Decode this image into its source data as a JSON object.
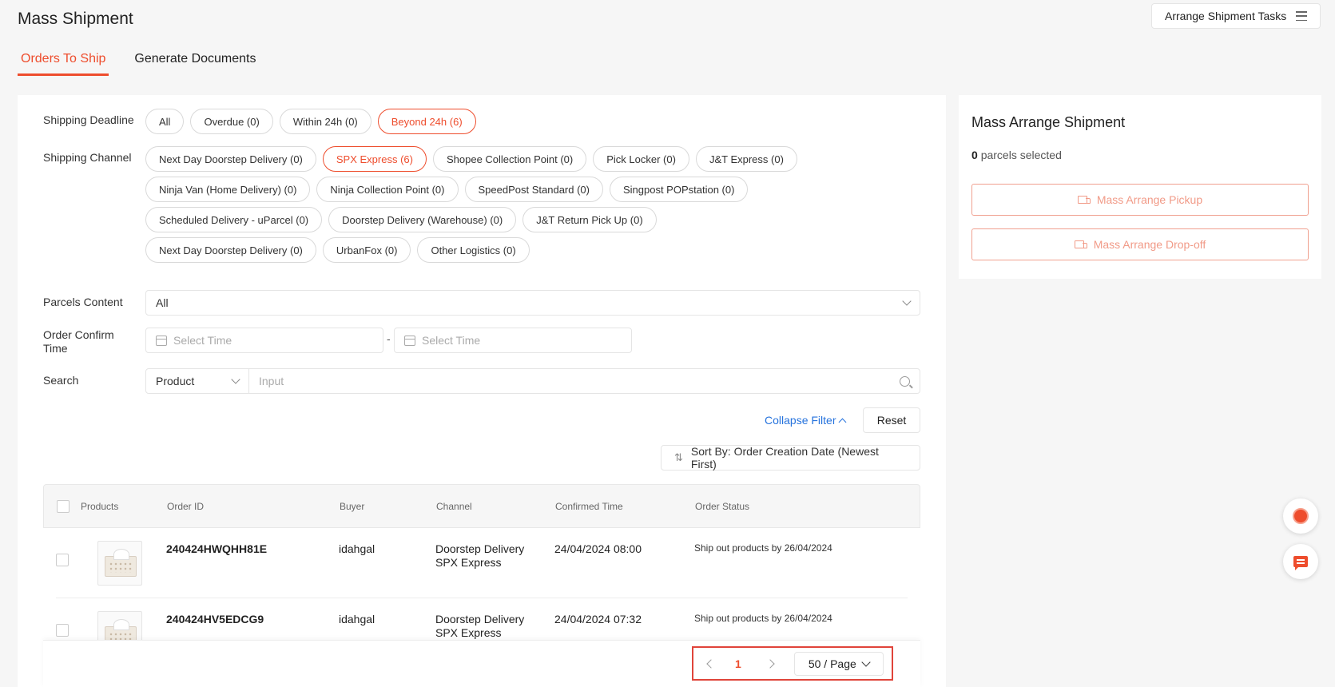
{
  "header": {
    "title": "Mass Shipment",
    "tasks_button": "Arrange Shipment Tasks"
  },
  "tabs": [
    {
      "label": "Orders To Ship",
      "active": true
    },
    {
      "label": "Generate Documents",
      "active": false
    }
  ],
  "filters": {
    "deadline_label": "Shipping Deadline",
    "deadline_options": [
      "All",
      "Overdue (0)",
      "Within 24h (0)",
      "Beyond 24h (6)"
    ],
    "deadline_selected": "Beyond 24h (6)",
    "channel_label": "Shipping Channel",
    "channel_options": [
      "Next Day Doorstep Delivery (0)",
      "SPX Express (6)",
      "Shopee Collection Point (0)",
      "Pick Locker (0)",
      "J&T Express (0)",
      "Ninja Van (Home Delivery) (0)",
      "Ninja Collection Point (0)",
      "SpeedPost Standard (0)",
      "Singpost POPstation (0)",
      "Scheduled Delivery - uParcel (0)",
      "Doorstep Delivery (Warehouse) (0)",
      "J&T Return Pick Up (0)",
      "Next Day Doorstep Delivery (0)",
      "UrbanFox (0)",
      "Other Logistics (0)"
    ],
    "channel_selected": "SPX Express (6)",
    "parcels_label": "Parcels Content",
    "parcels_value": "All",
    "confirm_label": "Order Confirm Time",
    "time_placeholder_start": "Select Time",
    "time_placeholder_end": "Select Time",
    "time_separator": "-",
    "search_label": "Search",
    "search_type": "Product",
    "search_placeholder": "Input",
    "collapse_label": "Collapse Filter",
    "reset_label": "Reset",
    "sort_label": "Sort By: Order Creation Date (Newest First)"
  },
  "table": {
    "headers": [
      "Products",
      "Order ID",
      "Buyer",
      "Channel",
      "Confirmed Time",
      "Order Status"
    ],
    "rows": [
      {
        "order_id": "240424HWQHH81E",
        "buyer": "idahgal",
        "channel_line1": "Doorstep Delivery",
        "channel_line2": "SPX Express",
        "confirmed": "24/04/2024 08:00",
        "status": "Ship out products by 26/04/2024"
      },
      {
        "order_id": "240424HV5EDCG9",
        "buyer": "idahgal",
        "channel_line1": "Doorstep Delivery",
        "channel_line2": "SPX Express",
        "confirmed": "24/04/2024 07:32",
        "status": "Ship out products by 26/04/2024"
      }
    ]
  },
  "pagination": {
    "current_page": "1",
    "per_page": "50 / Page"
  },
  "side": {
    "title": "Mass Arrange Shipment",
    "selected_count": "0",
    "selected_suffix": "parcels selected",
    "pickup_button": "Mass Arrange Pickup",
    "dropoff_button": "Mass Arrange Drop-off"
  },
  "colors": {
    "accent": "#ee4d2d",
    "link": "#2673dd",
    "pager_highlight": "#e0443a"
  },
  "icons": [
    "menu-icon",
    "calendar-icon",
    "search-icon",
    "chevron-down-icon",
    "chevron-up-icon",
    "sort-icon",
    "truck-icon",
    "chatbot-icon",
    "chat-icon"
  ]
}
